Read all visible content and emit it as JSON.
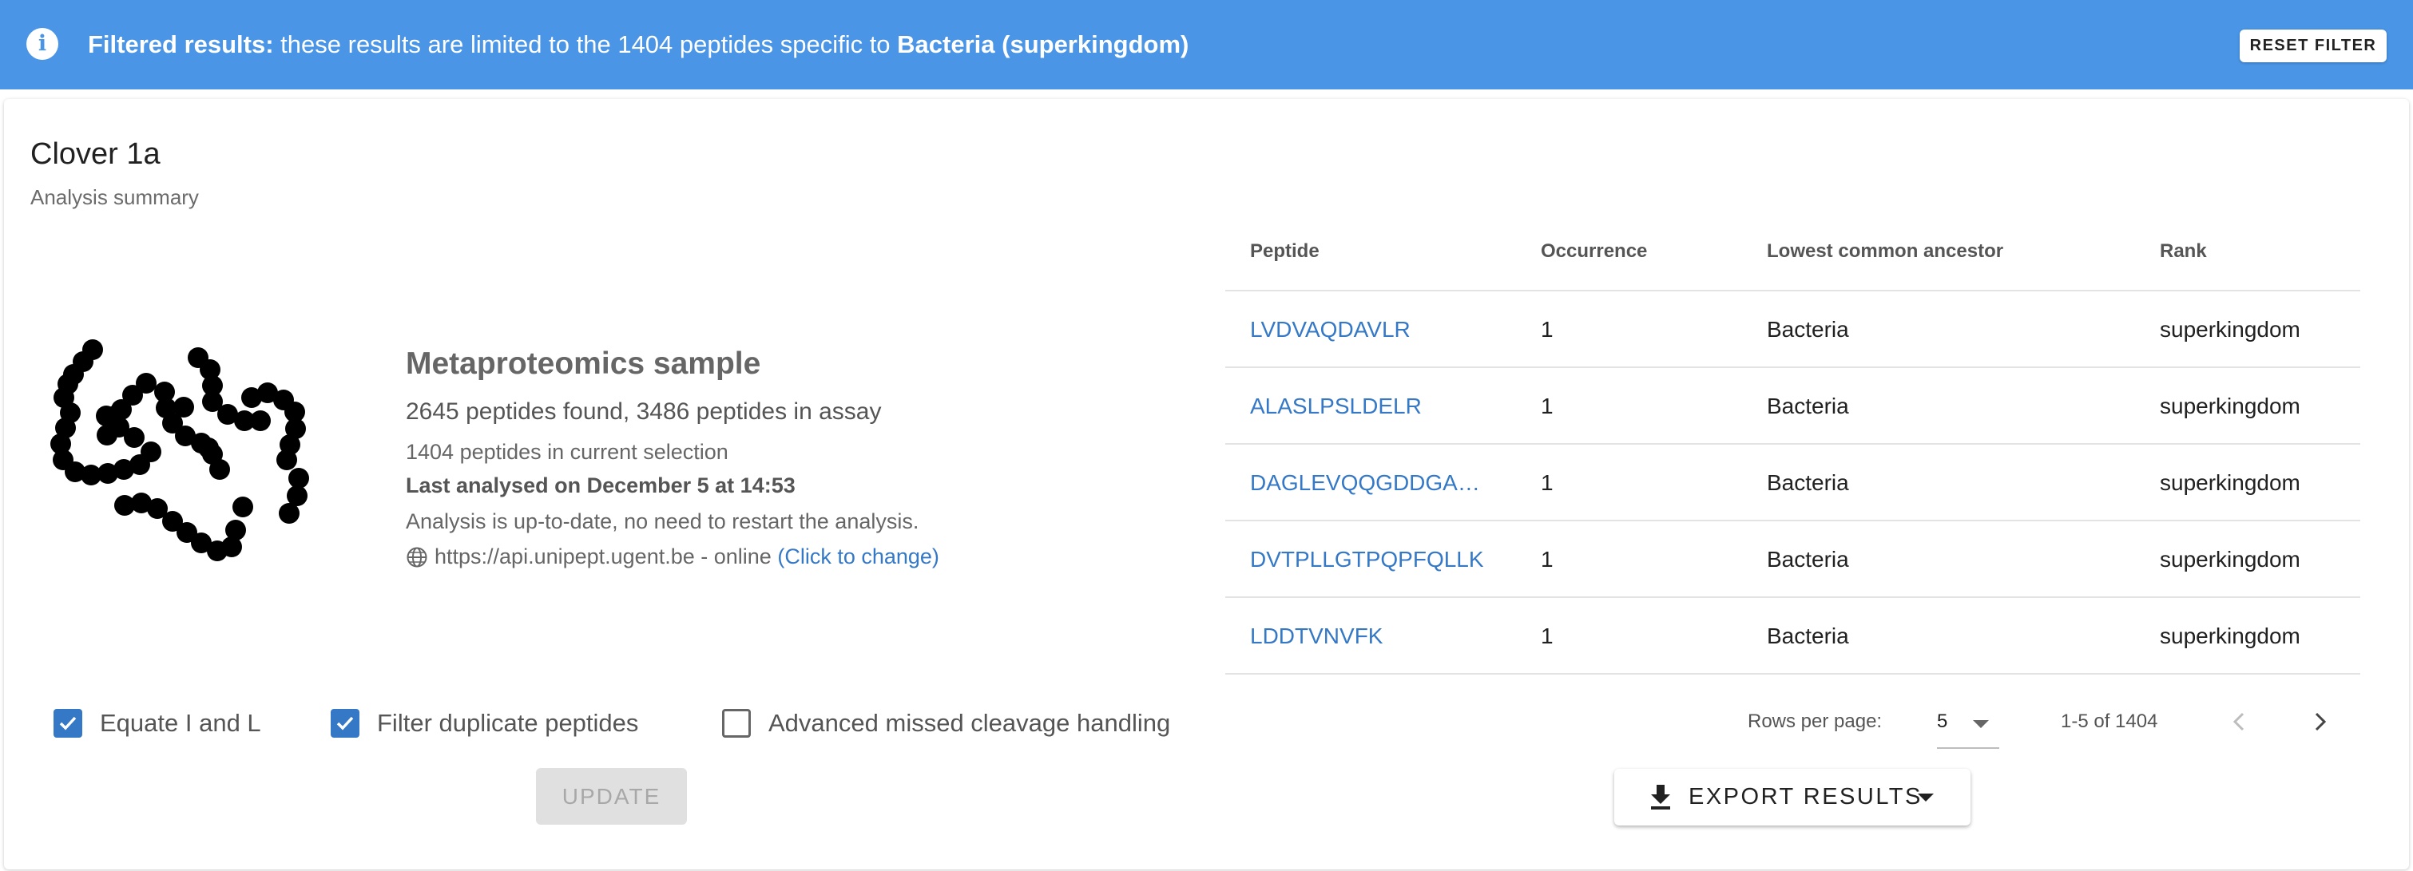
{
  "banner": {
    "bold_prefix": "Filtered results:",
    "text": " these results are limited to the 1404 peptides specific to ",
    "taxon": "Bacteria (superkingdom)",
    "reset_label": "RESET FILTER",
    "color": "#4a95e6"
  },
  "card": {
    "title": "Clover 1a",
    "subtitle": "Analysis summary"
  },
  "summary": {
    "icon": "molecule-chain-icon",
    "heading": "Metaproteomics sample",
    "found": "2645 peptides found, 3486 peptides in assay",
    "selection": "1404 peptides in current selection",
    "last_analysed": "Last analysed on December 5 at 14:53",
    "status": "Analysis is up-to-date, no need to restart the analysis.",
    "endpoint": "https://api.unipept.ugent.be - online",
    "change_link": "(Click to change)"
  },
  "options": {
    "equate_il": {
      "label": "Equate I and L",
      "checked": true
    },
    "filter_duplicates": {
      "label": "Filter duplicate peptides",
      "checked": true
    },
    "missed_cleavage": {
      "label": "Advanced missed cleavage handling",
      "checked": false
    },
    "update_label": "UPDATE"
  },
  "table": {
    "headers": [
      "Peptide",
      "Occurrence",
      "Lowest common ancestor",
      "Rank"
    ],
    "rows": [
      {
        "peptide": "LVDVAQDAVLR",
        "occurrence": "1",
        "lca": "Bacteria",
        "rank": "superkingdom"
      },
      {
        "peptide": "ALASLPSLDELR",
        "occurrence": "1",
        "lca": "Bacteria",
        "rank": "superkingdom"
      },
      {
        "peptide": "DAGLEVQQGDDGA…",
        "occurrence": "1",
        "lca": "Bacteria",
        "rank": "superkingdom"
      },
      {
        "peptide": "DVTPLLGTPQPFQLLK",
        "occurrence": "1",
        "lca": "Bacteria",
        "rank": "superkingdom"
      },
      {
        "peptide": "LDDTVNVFK",
        "occurrence": "1",
        "lca": "Bacteria",
        "rank": "superkingdom"
      }
    ]
  },
  "pagination": {
    "rows_per_page_label": "Rows per page:",
    "rows_per_page": "5",
    "range": "1-5 of 1404"
  },
  "export": {
    "label": "EXPORT RESULTS"
  },
  "colors": {
    "accent": "#3478c6",
    "banner": "#4a95e6"
  }
}
